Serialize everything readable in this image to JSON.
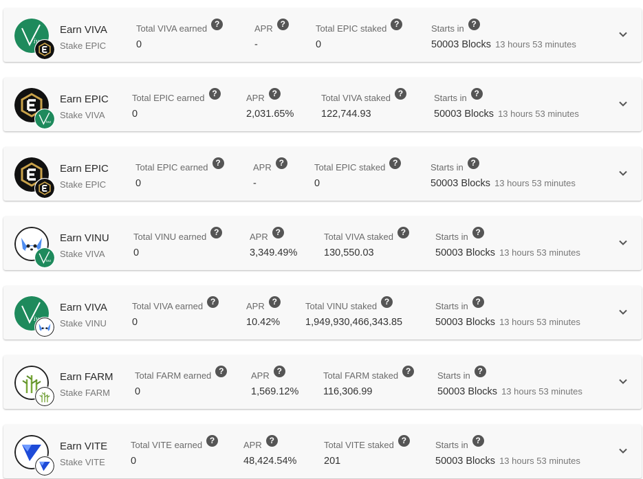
{
  "colors": {
    "viva_green": "#1e8a5c",
    "epic_black": "#111111",
    "epic_gold": "#c9a24a",
    "vite_blue": "#1e4bd8",
    "card_bg": "#f8f8f8"
  },
  "pools": [
    {
      "earn": "Earn VIVA",
      "stake": "Stake EPIC",
      "main_icon": "viva-token-icon",
      "sub_icon": "epic-token-icon",
      "earned_label": "Total VIVA earned",
      "earned": "0",
      "apr_label": "APR",
      "apr": "-",
      "staked_label": "Total EPIC staked",
      "staked": "0",
      "starts_label": "Starts in",
      "blocks": "50003 Blocks",
      "time": "13 hours 53 minutes"
    },
    {
      "earn": "Earn EPIC",
      "stake": "Stake VIVA",
      "main_icon": "epic-token-icon",
      "sub_icon": "viva-token-icon",
      "earned_label": "Total EPIC earned",
      "earned": "0",
      "apr_label": "APR",
      "apr": "2,031.65%",
      "staked_label": "Total VIVA staked",
      "staked": "122,744.93",
      "starts_label": "Starts in",
      "blocks": "50003 Blocks",
      "time": "13 hours 53 minutes"
    },
    {
      "earn": "Earn EPIC",
      "stake": "Stake EPIC",
      "main_icon": "epic-token-icon",
      "sub_icon": "epic-token-icon",
      "earned_label": "Total EPIC earned",
      "earned": "0",
      "apr_label": "APR",
      "apr": "-",
      "staked_label": "Total EPIC staked",
      "staked": "0",
      "starts_label": "Starts in",
      "blocks": "50003 Blocks",
      "time": "13 hours 53 minutes"
    },
    {
      "earn": "Earn VINU",
      "stake": "Stake VIVA",
      "main_icon": "vinu-token-icon",
      "sub_icon": "viva-token-icon",
      "earned_label": "Total VINU earned",
      "earned": "0",
      "apr_label": "APR",
      "apr": "3,349.49%",
      "staked_label": "Total VIVA staked",
      "staked": "130,550.03",
      "starts_label": "Starts in",
      "blocks": "50003 Blocks",
      "time": "13 hours 53 minutes"
    },
    {
      "earn": "Earn VIVA",
      "stake": "Stake VINU",
      "main_icon": "viva-token-icon",
      "sub_icon": "vinu-token-icon",
      "earned_label": "Total VIVA earned",
      "earned": "0",
      "apr_label": "APR",
      "apr": "10.42%",
      "staked_label": "Total VINU staked",
      "staked": "1,949,930,466,343.85",
      "starts_label": "Starts in",
      "blocks": "50003 Blocks",
      "time": "13 hours 53 minutes"
    },
    {
      "earn": "Earn FARM",
      "stake": "Stake FARM",
      "main_icon": "farm-token-icon",
      "sub_icon": "farm-token-icon",
      "earned_label": "Total FARM earned",
      "earned": "0",
      "apr_label": "APR",
      "apr": "1,569.12%",
      "staked_label": "Total FARM staked",
      "staked": "116,306.99",
      "starts_label": "Starts in",
      "blocks": "50003 Blocks",
      "time": "13 hours 53 minutes"
    },
    {
      "earn": "Earn VITE",
      "stake": "Stake VITE",
      "main_icon": "vite-token-icon",
      "sub_icon": "vite-token-icon",
      "earned_label": "Total VITE earned",
      "earned": "0",
      "apr_label": "APR",
      "apr": "48,424.54%",
      "staked_label": "Total VITE staked",
      "staked": "201",
      "starts_label": "Starts in",
      "blocks": "50003 Blocks",
      "time": "13 hours 53 minutes"
    }
  ]
}
